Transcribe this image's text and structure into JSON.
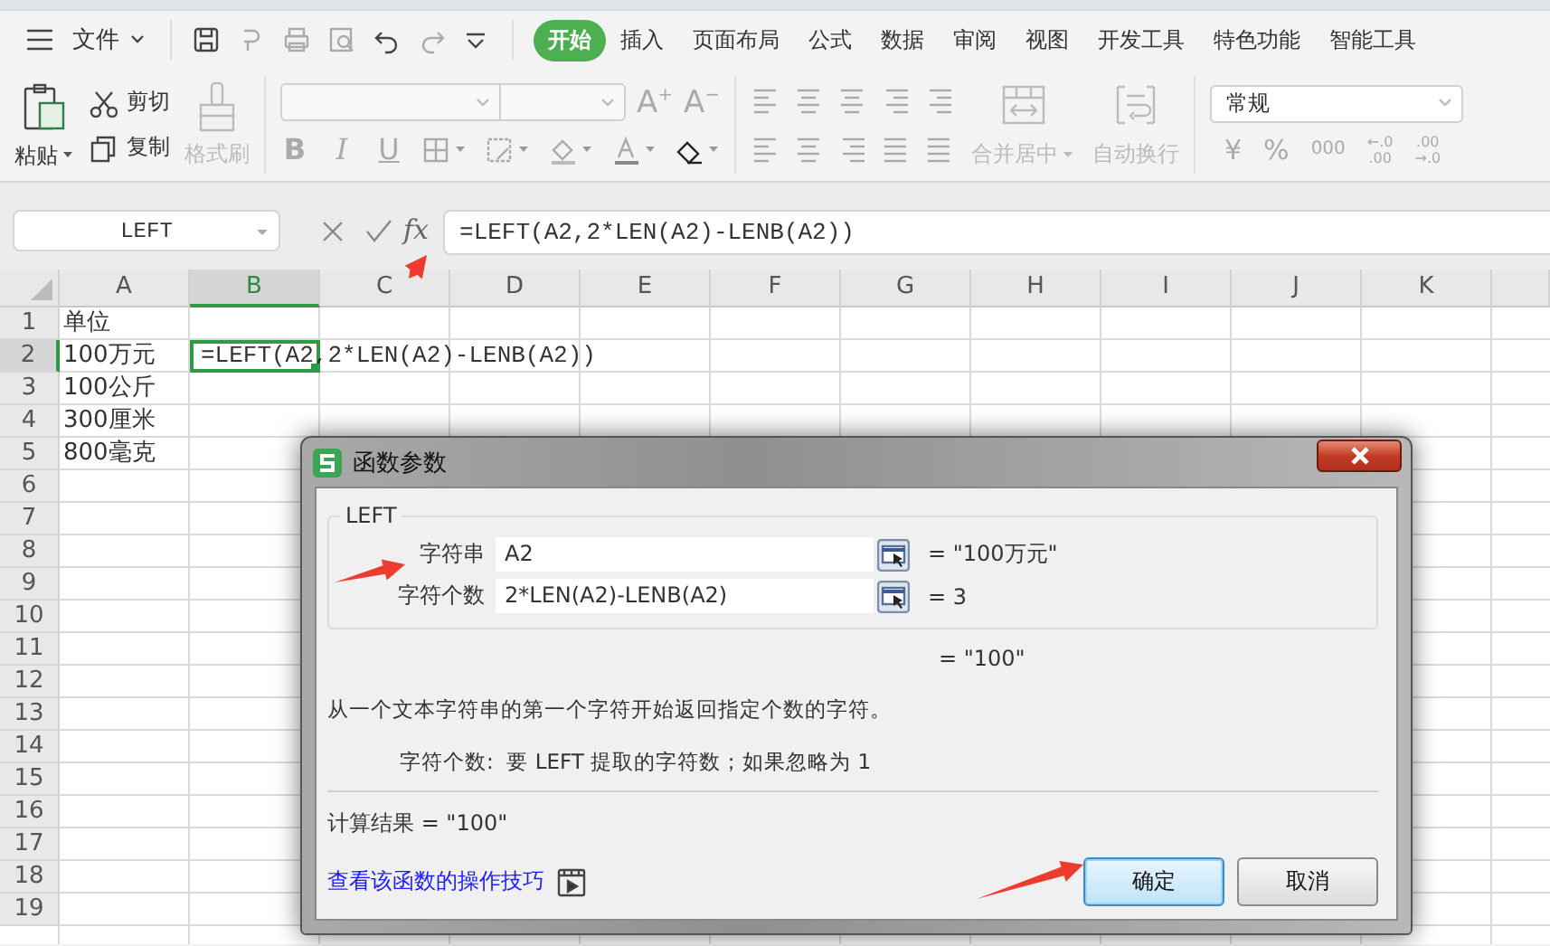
{
  "menu_bar": {
    "file_menu": "文件",
    "tabs": [
      {
        "label": "开始",
        "selected": true
      },
      {
        "label": "插入",
        "selected": false
      },
      {
        "label": "页面布局",
        "selected": false
      },
      {
        "label": "公式",
        "selected": false
      },
      {
        "label": "数据",
        "selected": false
      },
      {
        "label": "审阅",
        "selected": false
      },
      {
        "label": "视图",
        "selected": false
      },
      {
        "label": "开发工具",
        "selected": false
      },
      {
        "label": "特色功能",
        "selected": false
      },
      {
        "label": "智能工具",
        "selected": false
      }
    ]
  },
  "ribbon": {
    "paste": "粘贴",
    "clipboard": [
      {
        "label": "剪切",
        "disabled": false
      },
      {
        "label": "复制",
        "disabled": false
      },
      {
        "label": "格式刷",
        "disabled": true
      }
    ],
    "grow_shrink": [
      "A$^{+}$",
      "A$^{−}$"
    ],
    "font_styles": [
      "B",
      "I",
      "U"
    ],
    "merge": {
      "label": "合并居中",
      "disabled": true
    },
    "wrap": {
      "label": "自动换行",
      "disabled": true
    },
    "number_format": "常规",
    "number_buttons": [
      "¥",
      "%",
      "000"
    ],
    "decimal_buttons": [
      {
        "top": "←.0",
        "bottom": ".00"
      },
      {
        "top": ".00",
        "bottom": "→.0"
      }
    ]
  },
  "formula_bar": {
    "name_box": "LEFT",
    "fx": "fx",
    "formula": "=LEFT(A2,2*LEN(A2)-LENB(A2))"
  },
  "sheet": {
    "columns": [
      {
        "label": "A",
        "selected": false
      },
      {
        "label": "B",
        "selected": true
      },
      {
        "label": "C",
        "selected": false
      },
      {
        "label": "D",
        "selected": false
      },
      {
        "label": "E",
        "selected": false
      },
      {
        "label": "F",
        "selected": false
      },
      {
        "label": "G",
        "selected": false
      },
      {
        "label": "H",
        "selected": false
      },
      {
        "label": "I",
        "selected": false
      },
      {
        "label": "J",
        "selected": false
      },
      {
        "label": "K",
        "selected": false
      }
    ],
    "rows": [
      {
        "label": "1",
        "selected": false,
        "cells": [
          {
            "text": "单位",
            "selected": false
          }
        ]
      },
      {
        "label": "2",
        "selected": true,
        "cells": [
          {
            "text": "100万元",
            "selected": false
          },
          {
            "text": "=LEFT(A2,2*LEN(A2)-LENB(A2))",
            "selected": true
          }
        ]
      },
      {
        "label": "3",
        "selected": false,
        "cells": [
          {
            "text": "100公斤",
            "selected": false
          }
        ]
      },
      {
        "label": "4",
        "selected": false,
        "cells": [
          {
            "text": "300厘米",
            "selected": false
          }
        ]
      },
      {
        "label": "5",
        "selected": false,
        "cells": [
          {
            "text": "800毫克",
            "selected": false
          }
        ]
      },
      {
        "label": "6",
        "selected": false
      },
      {
        "label": "7",
        "selected": false
      },
      {
        "label": "8",
        "selected": false
      },
      {
        "label": "9",
        "selected": false
      },
      {
        "label": "10",
        "selected": false
      },
      {
        "label": "11",
        "selected": false
      },
      {
        "label": "12",
        "selected": false
      },
      {
        "label": "13",
        "selected": false
      },
      {
        "label": "14",
        "selected": false
      },
      {
        "label": "15",
        "selected": false
      },
      {
        "label": "16",
        "selected": false
      },
      {
        "label": "17",
        "selected": false
      },
      {
        "label": "18",
        "selected": false
      },
      {
        "label": "19",
        "selected": false
      }
    ]
  },
  "dialog": {
    "title": "函数参数",
    "function_name": "LEFT",
    "arguments": [
      {
        "label": "字符串",
        "value": "A2",
        "result": "= \"100万元\""
      },
      {
        "label": "字符个数",
        "value": "2*LEN(A2)-LENB(A2)",
        "result": "= 3"
      }
    ],
    "formula_result": "= \"100\"",
    "description": "从一个文本字符串的第一个字符开始返回指定个数的字符。",
    "argument_help": "字符个数:  要 LEFT 提取的字符数；如果忽略为 1",
    "calculation_result": "计算结果 = \"100\"",
    "help_link": "查看该函数的操作技巧",
    "buttons": [
      {
        "label": "确定",
        "kind": "primary"
      },
      {
        "label": "取消",
        "kind": "normal"
      }
    ]
  }
}
